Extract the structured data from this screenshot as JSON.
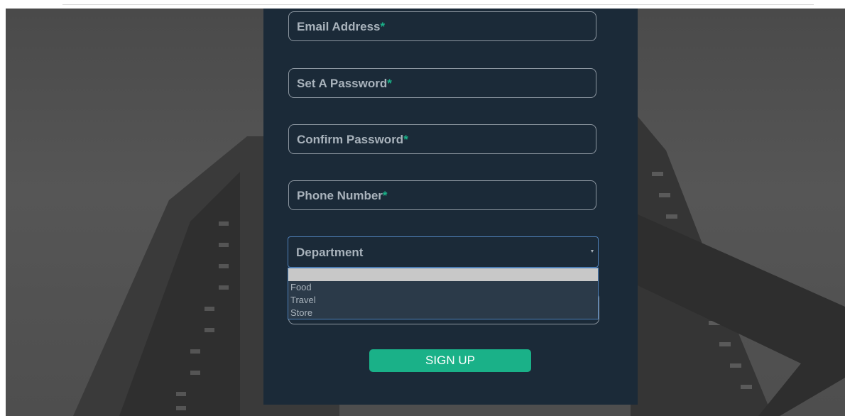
{
  "form": {
    "fields": [
      {
        "label": "Email Address",
        "required_mark": "*"
      },
      {
        "label": "Set A Password",
        "required_mark": "*"
      },
      {
        "label": "Confirm Password",
        "required_mark": "*"
      },
      {
        "label": "Phone Number",
        "required_mark": "*"
      }
    ],
    "department": {
      "label": "Department",
      "options": [
        "",
        "Food",
        "Travel",
        "Store"
      ]
    },
    "submit_label": "SIGN UP"
  },
  "colors": {
    "panel": "#1b2a38",
    "accent": "#1ab188",
    "label": "#a9b3bc",
    "focus_border": "#4e7fb7"
  }
}
